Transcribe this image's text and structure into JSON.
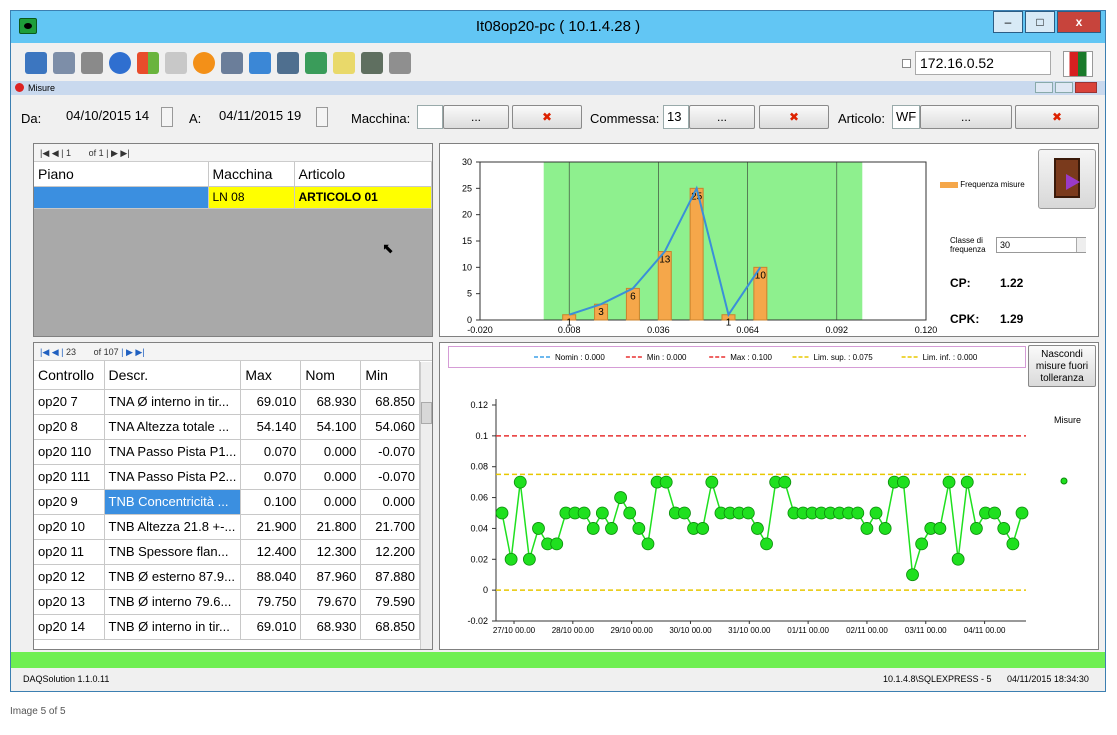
{
  "window": {
    "title": "It08op20-pc ( 10.1.4.28 )",
    "controls": {
      "minimize": "–",
      "maximize": "□",
      "close": "x"
    }
  },
  "toolbar": {
    "icons": [
      "monitor-icon",
      "tree-icon",
      "tools-icon",
      "refresh-icon",
      "windows-icon",
      "printer-icon",
      "alert-icon",
      "grid-icon",
      "fullscreen-icon",
      "display-icon",
      "export-icon",
      "note-icon",
      "frame-icon",
      "copy-icon"
    ],
    "ip": "172.16.0.52"
  },
  "subwindow": {
    "title": "Misure"
  },
  "filters": {
    "da_label": "Da:",
    "da_value": "04/10/2015 14",
    "a_label": "A:",
    "a_value": "04/11/2015 19",
    "macchina_label": "Macchina:",
    "macchina_value": "",
    "commessa_label": "Commessa:",
    "commessa_value": "13",
    "articolo_label": "Articolo:",
    "articolo_value": "WF",
    "select_label": "...",
    "clear_label": "✖"
  },
  "top_grid": {
    "nav": {
      "page": "1",
      "of": "of 1"
    },
    "headers": [
      "Piano",
      "Macchina",
      "Articolo"
    ],
    "rows": [
      [
        "",
        "LN 08",
        "ARTICOLO 01"
      ]
    ]
  },
  "bottom_grid": {
    "nav": {
      "page": "23",
      "of": "of 107"
    },
    "headers": [
      "Controllo",
      "Descr.",
      "Max",
      "Nom",
      "Min"
    ],
    "rows": [
      [
        "op20 7",
        "TNA Ø interno in tir...",
        "69.010",
        "68.930",
        "68.850"
      ],
      [
        "op20 8",
        "TNA Altezza totale ...",
        "54.140",
        "54.100",
        "54.060"
      ],
      [
        "op20 110",
        "TNA Passo Pista P1...",
        "0.070",
        "0.000",
        "-0.070"
      ],
      [
        "op20 111",
        "TNA Passo Pista P2...",
        "0.070",
        "0.000",
        "-0.070"
      ],
      [
        "op20 9",
        "TNB Concentricità ...",
        "0.100",
        "0.000",
        "0.000"
      ],
      [
        "op20 10",
        "TNB Altezza 21.8 +-...",
        "21.900",
        "21.800",
        "21.700"
      ],
      [
        "op20 11",
        "TNB Spessore flan...",
        "12.400",
        "12.300",
        "12.200"
      ],
      [
        "op20 12",
        "TNB Ø esterno 87.9...",
        "88.040",
        "87.960",
        "87.880"
      ],
      [
        "op20 13",
        "TNB Ø interno 79.6...",
        "79.750",
        "79.670",
        "79.590"
      ],
      [
        "op20 14",
        "TNB Ø interno in tir...",
        "69.010",
        "68.930",
        "68.850"
      ]
    ]
  },
  "histogram_side": {
    "legend": "Frequenza misure",
    "classe_label": "Classe di frequenza",
    "classe_value": "30",
    "cp_label": "CP:",
    "cp_value": "1.22",
    "cpk_label": "CPK:",
    "cpk_value": "1.29"
  },
  "line_side": {
    "hide_button": "Nascondi misure fuori tolleranza",
    "series_label": "Misure"
  },
  "status": {
    "app": "DAQSolution 1.1.0.11",
    "server": "10.1.4.8\\SQLEXPRESS - 5",
    "datetime": "04/11/2015 18:34:30"
  },
  "below_window": "Image 5 of 5",
  "chart_data": [
    {
      "type": "bar",
      "categories": [
        0.008,
        0.018,
        0.028,
        0.038,
        0.048,
        0.058,
        0.068
      ],
      "values": [
        1,
        3,
        6,
        13,
        25,
        1,
        10
      ],
      "series": [
        {
          "name": "Frequenza misure",
          "values": [
            1,
            3,
            6,
            13,
            25,
            1,
            10
          ]
        }
      ],
      "xlim": [
        -0.02,
        0.12
      ],
      "ylim": [
        0,
        30
      ],
      "x_ticks": [
        "-0.020",
        "0.008",
        "0.036",
        "0.064",
        "0.092",
        "0.120"
      ],
      "y_ticks": [
        "0",
        "5",
        "10",
        "15",
        "20",
        "25",
        "30"
      ],
      "tolerance_band": [
        0.0,
        0.1
      ]
    },
    {
      "type": "line",
      "legend": [
        {
          "name": "Nomin : 0.000",
          "value": 0.0,
          "color": "#3da0e8",
          "dash": true
        },
        {
          "name": "Min : 0.000",
          "value": 0.0,
          "color": "#e83030",
          "dash": true
        },
        {
          "name": "Max : 0.100",
          "value": 0.1,
          "color": "#e83030",
          "dash": true
        },
        {
          "name": "Lim. sup. : 0.075",
          "value": 0.075,
          "color": "#e8c800",
          "dash": true
        },
        {
          "name": "Lim. inf. : 0.000",
          "value": 0.0,
          "color": "#e8c800",
          "dash": true
        }
      ],
      "ylim": [
        -0.02,
        0.12
      ],
      "y_ticks": [
        "-0.02",
        "0",
        "0.02",
        "0.04",
        "0.06",
        "0.08",
        "0.1",
        "0.12"
      ],
      "x_ticks": [
        "27/10 00.00",
        "28/10 00.00",
        "29/10 00.00",
        "30/10 00.00",
        "31/10 00.00",
        "01/11 00.00",
        "02/11 00.00",
        "03/11 00.00",
        "04/11 00.00"
      ],
      "series": [
        {
          "name": "Misure",
          "color": "#1fe01f",
          "values": [
            0.05,
            0.02,
            0.07,
            0.02,
            0.04,
            0.03,
            0.03,
            0.05,
            0.05,
            0.05,
            0.04,
            0.05,
            0.04,
            0.06,
            0.05,
            0.04,
            0.03,
            0.07,
            0.07,
            0.05,
            0.05,
            0.04,
            0.04,
            0.07,
            0.05,
            0.05,
            0.05,
            0.05,
            0.04,
            0.03,
            0.07,
            0.07,
            0.05,
            0.05,
            0.05,
            0.05,
            0.05,
            0.05,
            0.05,
            0.05,
            0.04,
            0.05,
            0.04,
            0.07,
            0.07,
            0.01,
            0.03,
            0.04,
            0.04,
            0.07,
            0.02,
            0.07,
            0.04,
            0.05,
            0.05,
            0.04,
            0.03,
            0.05
          ]
        }
      ]
    }
  ]
}
